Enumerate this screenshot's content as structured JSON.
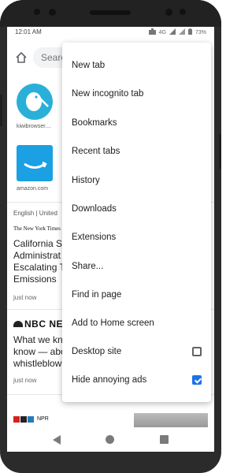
{
  "status_bar": {
    "time": "12:01 AM",
    "network": "4G",
    "battery": "73%"
  },
  "toolbar": {
    "search_placeholder": "Search"
  },
  "tiles": [
    {
      "label": "kiwibrowser....",
      "color": "#2ab0d8",
      "icon": "kiwi-bird-icon"
    },
    {
      "label": "amazon.com",
      "color": "#1aa0e3",
      "icon": "amazon-smile-icon"
    }
  ],
  "feed": {
    "locale": "English | United",
    "articles": [
      {
        "source": "The New York Times",
        "headline_lines": [
          "California S",
          "Administrat",
          "Escalating T",
          "Emissions"
        ],
        "time": "just now"
      },
      {
        "source": "NBC NEWS",
        "headline_lines": [
          "What we kn",
          "know — abo",
          "whistleblow"
        ],
        "time": "just now"
      },
      {
        "source": "NPR",
        "headline_lines": [],
        "time": ""
      }
    ]
  },
  "menu": {
    "items": [
      {
        "label": "New tab"
      },
      {
        "label": "New incognito tab"
      },
      {
        "label": "Bookmarks"
      },
      {
        "label": "Recent tabs"
      },
      {
        "label": "History"
      },
      {
        "label": "Downloads"
      },
      {
        "label": "Extensions"
      },
      {
        "label": "Share..."
      },
      {
        "label": "Find in page"
      },
      {
        "label": "Add to Home screen"
      },
      {
        "label": "Desktop site",
        "checkbox": true,
        "checked": false
      },
      {
        "label": "Hide annoying ads",
        "checkbox": true,
        "checked": true
      }
    ]
  },
  "colors": {
    "accent": "#1a73e8"
  }
}
